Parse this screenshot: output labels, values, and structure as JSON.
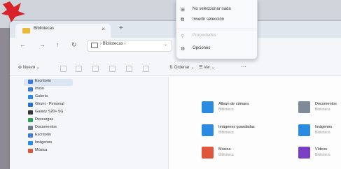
{
  "tab": {
    "title": "Bibliotecas",
    "close": "×",
    "new": "+"
  },
  "nav": {
    "back": "←",
    "forward": "→",
    "up": "↑",
    "refresh": "↻",
    "chevron": "›",
    "breadcrumb": "Bibliotecas",
    "crumb_sep": "›",
    "dropdown": "⌄"
  },
  "toolbar": {
    "new_label": "Nuevo",
    "sort_label": "Ordenar",
    "view_label": "Ver",
    "more_label": "···"
  },
  "menu": {
    "items": [
      {
        "icon": "select-none-icon",
        "glyph": "⊞",
        "label": "No seleccionar nada",
        "enabled": true
      },
      {
        "icon": "invert-selection-icon",
        "glyph": "⧉",
        "label": "Invertir selección",
        "enabled": true
      },
      {
        "icon": "properties-icon",
        "glyph": "⚲",
        "label": "Propiedades",
        "enabled": false
      },
      {
        "icon": "options-icon",
        "glyph": "⚙",
        "label": "Opciones",
        "enabled": true
      }
    ]
  },
  "sidebar": {
    "items": [
      {
        "label": "Escritorio",
        "color": "#3b78d8"
      },
      {
        "label": "Inicio",
        "color": "#3b78d8"
      },
      {
        "label": "Galería",
        "color": "#2b8be0"
      },
      {
        "label": "Ghunt - Personal",
        "color": "#1e6fd9"
      },
      {
        "label": "Galaxy S20+ 5G",
        "color": "#333333"
      },
      {
        "label": "Descargas",
        "color": "#2aa05a"
      },
      {
        "label": "Documentos",
        "color": "#6e7a86"
      },
      {
        "label": "Escritorio",
        "color": "#3b78d8"
      },
      {
        "label": "Imágenes",
        "color": "#2b8be0"
      },
      {
        "label": "Música",
        "color": "#e0553b"
      }
    ]
  },
  "libraries": [
    {
      "name": "Álbum de cámara",
      "sub": "Biblioteca",
      "color": "#2b8be0"
    },
    {
      "name": "Documentos",
      "sub": "Biblioteca",
      "color": "#7d8a97"
    },
    {
      "name": "Imágenes guardadas",
      "sub": "Biblioteca",
      "color": "#2b8be0"
    },
    {
      "name": "Imágenes",
      "sub": "Biblioteca",
      "color": "#2b8be0"
    },
    {
      "name": "Música",
      "sub": "Biblioteca",
      "color": "#e0553b"
    },
    {
      "name": "Vídeos",
      "sub": "Biblioteca",
      "color": "#7b3fc4"
    }
  ]
}
